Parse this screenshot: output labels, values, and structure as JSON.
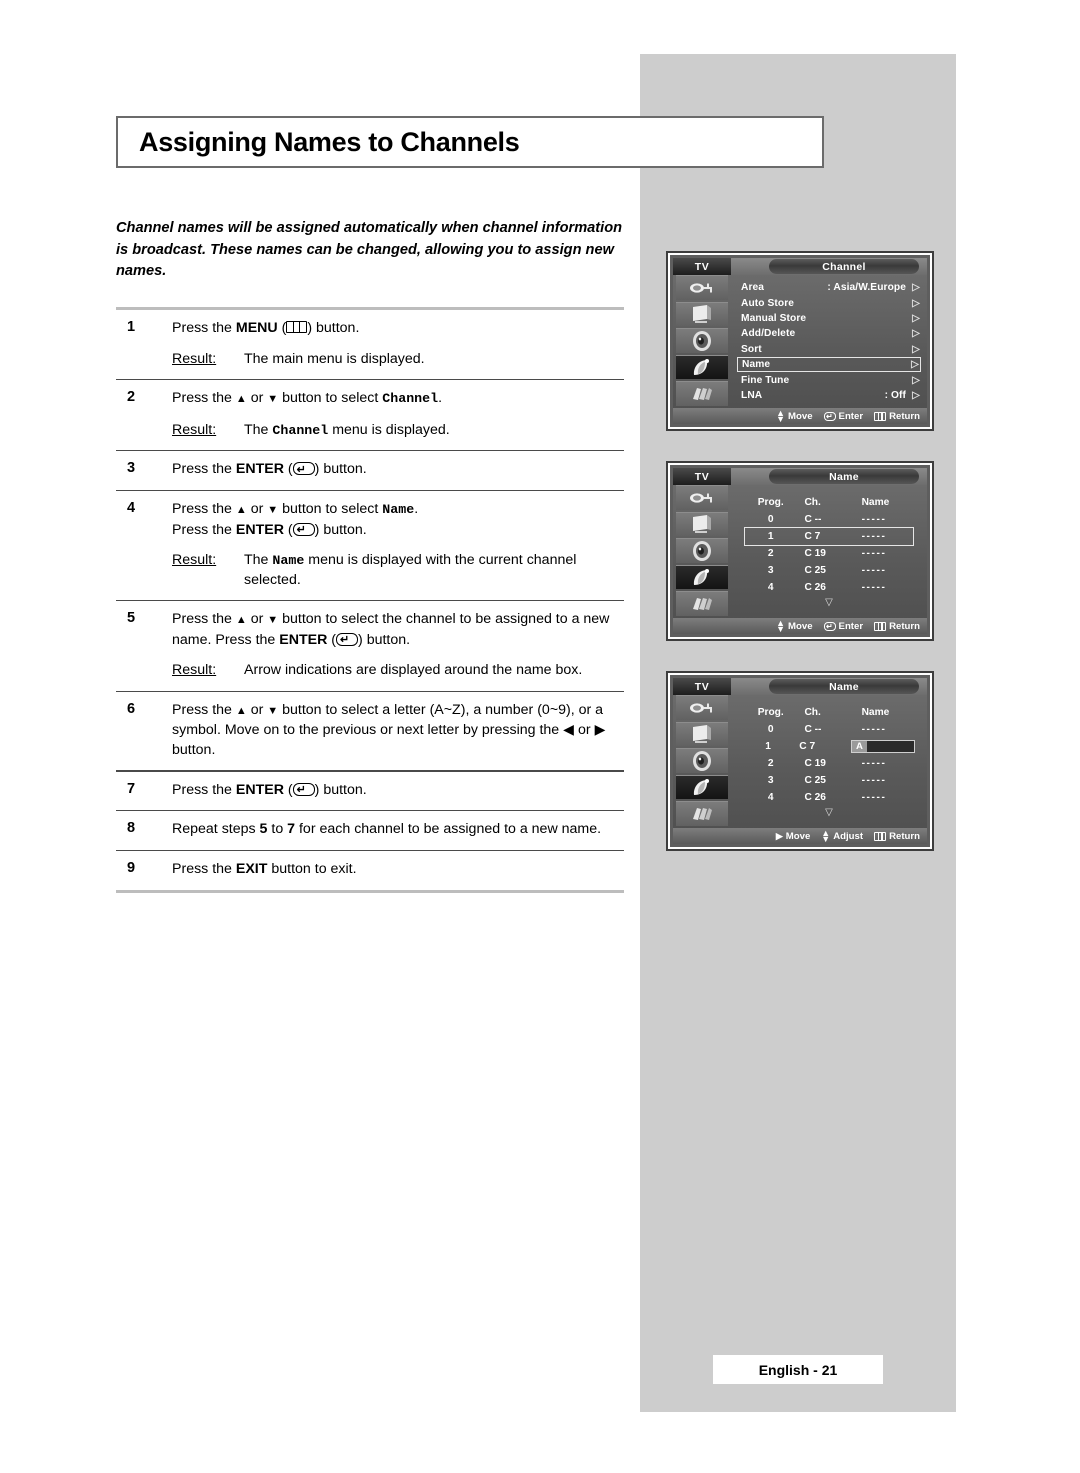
{
  "page": {
    "title": "Assigning Names to Channels",
    "intro": "Channel names will be assigned automatically when channel information is broadcast. These names can be changed, allowing you to assign new names.",
    "footer": "English - 21"
  },
  "steps": [
    {
      "num": "1",
      "lines": [
        "pre_menu",
        "post_menu"
      ],
      "pre_menu": "Press the ",
      "menu_label": "MENU",
      "post_menu": " button.",
      "result_label": "Result:",
      "result_text": "The main menu is displayed."
    },
    {
      "num": "2",
      "text_a": "Press the ",
      "text_b": " or ",
      "text_c": " button to select ",
      "target": "Channel",
      "text_d": ".",
      "result_label": "Result:",
      "result_a": "The ",
      "result_target": "Channel",
      "result_b": " menu is displayed."
    },
    {
      "num": "3",
      "text_a": "Press the ",
      "enter_label": "ENTER",
      "text_b": " button."
    },
    {
      "num": "4",
      "text_a": "Press the ",
      "text_b": " or ",
      "text_c": " button to select ",
      "target": "Name",
      "text_d": ".",
      "line2_a": "Press the ",
      "enter_label": "ENTER",
      "line2_b": " button.",
      "result_label": "Result:",
      "result_a": "The ",
      "result_target": "Name",
      "result_b": " menu is displayed with the current channel selected."
    },
    {
      "num": "5",
      "text_a": "Press the ",
      "text_b": " or ",
      "text_c": " button to select the channel to be assigned to a new name.  Press the ",
      "enter_label": "ENTER",
      "text_d": " button.",
      "result_label": "Result:",
      "result_text": "Arrow indications are displayed around the name box."
    },
    {
      "num": "6",
      "text_a": "Press the ",
      "text_b": " or ",
      "text_c": " button to select a letter (A~Z), a number (0~9), or a symbol. Move on to the previous or next letter by pressing the ",
      "text_d": " or ",
      "text_e": " button."
    },
    {
      "num": "7",
      "text_a": "Press the ",
      "enter_label": "ENTER",
      "text_b": " button."
    },
    {
      "num": "8",
      "text_a": "Repeat steps ",
      "from": "5",
      "text_b": " to ",
      "to": "7",
      "text_c": " for each channel to be assigned to a new name."
    },
    {
      "num": "9",
      "text_a": "Press the ",
      "exit_label": "EXIT",
      "text_b": " button to exit."
    }
  ],
  "osd": {
    "tv_tab": "TV",
    "sidebar_icons": [
      "input-plug-icon",
      "tv-monitor-icon",
      "speaker-icon",
      "satellite-dish-icon",
      "setup-film-icon"
    ],
    "screen1": {
      "title": "Channel",
      "rows": [
        {
          "label": "Area",
          "value": ": Asia/W.Europe",
          "arrow": "▷",
          "selected": false
        },
        {
          "label": "Auto Store",
          "value": "",
          "arrow": "▷",
          "selected": false
        },
        {
          "label": "Manual Store",
          "value": "",
          "arrow": "▷",
          "selected": false
        },
        {
          "label": "Add/Delete",
          "value": "",
          "arrow": "▷",
          "selected": false
        },
        {
          "label": "Sort",
          "value": "",
          "arrow": "▷",
          "selected": false
        },
        {
          "label": "Name",
          "value": "",
          "arrow": "▷",
          "selected": true
        },
        {
          "label": "Fine Tune",
          "value": "",
          "arrow": "▷",
          "selected": false
        },
        {
          "label": "LNA",
          "value": ": Off",
          "arrow": "▷",
          "selected": false
        }
      ],
      "footer": [
        {
          "glyph": "updown",
          "label": "Move"
        },
        {
          "glyph": "enter",
          "label": "Enter"
        },
        {
          "glyph": "menu",
          "label": "Return"
        }
      ]
    },
    "screen2": {
      "title": "Name",
      "headers": [
        "Prog.",
        "Ch.",
        "Name"
      ],
      "rows": [
        {
          "prog": "0",
          "ch": "C --",
          "name": "-----",
          "selected": false
        },
        {
          "prog": "1",
          "ch": "C 7",
          "name": "-----",
          "selected": true
        },
        {
          "prog": "2",
          "ch": "C 19",
          "name": "-----",
          "selected": false
        },
        {
          "prog": "3",
          "ch": "C 25",
          "name": "-----",
          "selected": false
        },
        {
          "prog": "4",
          "ch": "C 26",
          "name": "-----",
          "selected": false
        }
      ],
      "more_caret": "▽",
      "footer": [
        {
          "glyph": "updown",
          "label": "Move"
        },
        {
          "glyph": "enter",
          "label": "Enter"
        },
        {
          "glyph": "menu",
          "label": "Return"
        }
      ]
    },
    "screen3": {
      "title": "Name",
      "headers": [
        "Prog.",
        "Ch.",
        "Name"
      ],
      "rows": [
        {
          "prog": "0",
          "ch": "C --",
          "name": "-----",
          "editing": false
        },
        {
          "prog": "1",
          "ch": "C 7",
          "name": "A",
          "editing": true
        },
        {
          "prog": "2",
          "ch": "C 19",
          "name": "-----",
          "editing": false
        },
        {
          "prog": "3",
          "ch": "C 25",
          "name": "-----",
          "editing": false
        },
        {
          "prog": "4",
          "ch": "C 26",
          "name": "-----",
          "editing": false
        }
      ],
      "more_caret": "▽",
      "footer": [
        {
          "glyph": "right",
          "label": "Move"
        },
        {
          "glyph": "updown",
          "label": "Adjust"
        },
        {
          "glyph": "menu",
          "label": "Return"
        }
      ]
    }
  }
}
